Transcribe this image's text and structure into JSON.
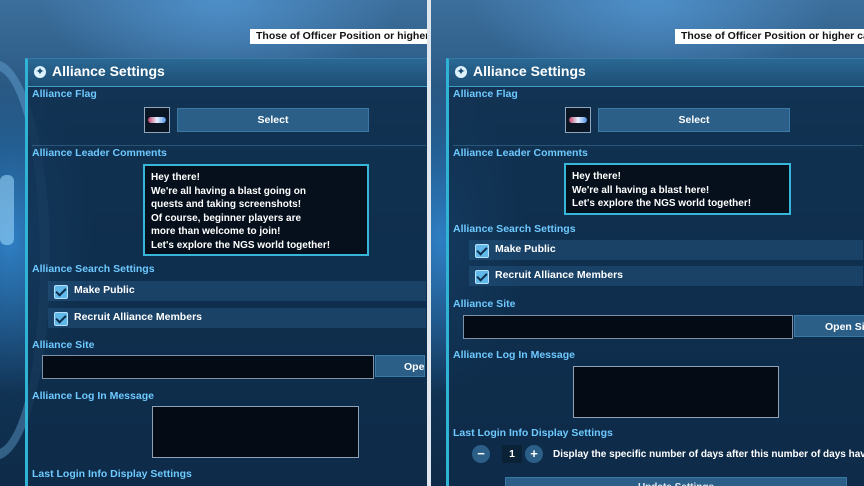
{
  "notice_text": "Those of Officer Position or higher can view",
  "left_panel": {
    "title": "Alliance Settings",
    "sections": {
      "flag": "Alliance Flag",
      "comments": "Alliance Leader Comments",
      "search": "Alliance Search Settings",
      "site": "Alliance Site",
      "login_message": "Alliance Log In Message",
      "last_login": "Last Login Info Display Settings"
    },
    "select_label": "Select",
    "comment_lines": [
      "Hey there!",
      "We're all having a blast going on",
      "quests and taking screenshots!",
      "Of course, beginner players are",
      "more than welcome to join!",
      "Let's explore the NGS world together!"
    ],
    "make_public_label": "Make Public",
    "make_public_checked": true,
    "recruit_label": "Recruit Alliance Members",
    "recruit_checked": true,
    "site_value": "",
    "open_label": "Open Site"
  },
  "right_panel": {
    "title": "Alliance Settings",
    "sections": {
      "flag": "Alliance Flag",
      "comments": "Alliance Leader Comments",
      "search": "Alliance Search Settings",
      "site": "Alliance Site",
      "login_message": "Alliance Log In Message",
      "last_login": "Last Login Info Display Settings"
    },
    "select_label": "Select",
    "comment_lines": [
      "Hey there!",
      "We're all having a blast here!",
      "Let's explore the NGS world together!"
    ],
    "make_public_label": "Make Public",
    "make_public_checked": true,
    "recruit_label": "Recruit Alliance Members",
    "recruit_checked": true,
    "site_value": "",
    "open_label": "Open Site",
    "days_minus": "−",
    "days_value": "1",
    "days_plus": "+",
    "days_text": "Display the specific number of days after this number of days have passed",
    "update_label": "Update Settings"
  },
  "icons": [
    "diamond-icon",
    "checkbox-checked-icon",
    "minus-icon",
    "plus-icon"
  ],
  "colors": {
    "panel_bg": "#0e2c4a",
    "section_label": "#6ec9ff",
    "accent_border": "#36b6d8",
    "button": "#2c5f88"
  }
}
